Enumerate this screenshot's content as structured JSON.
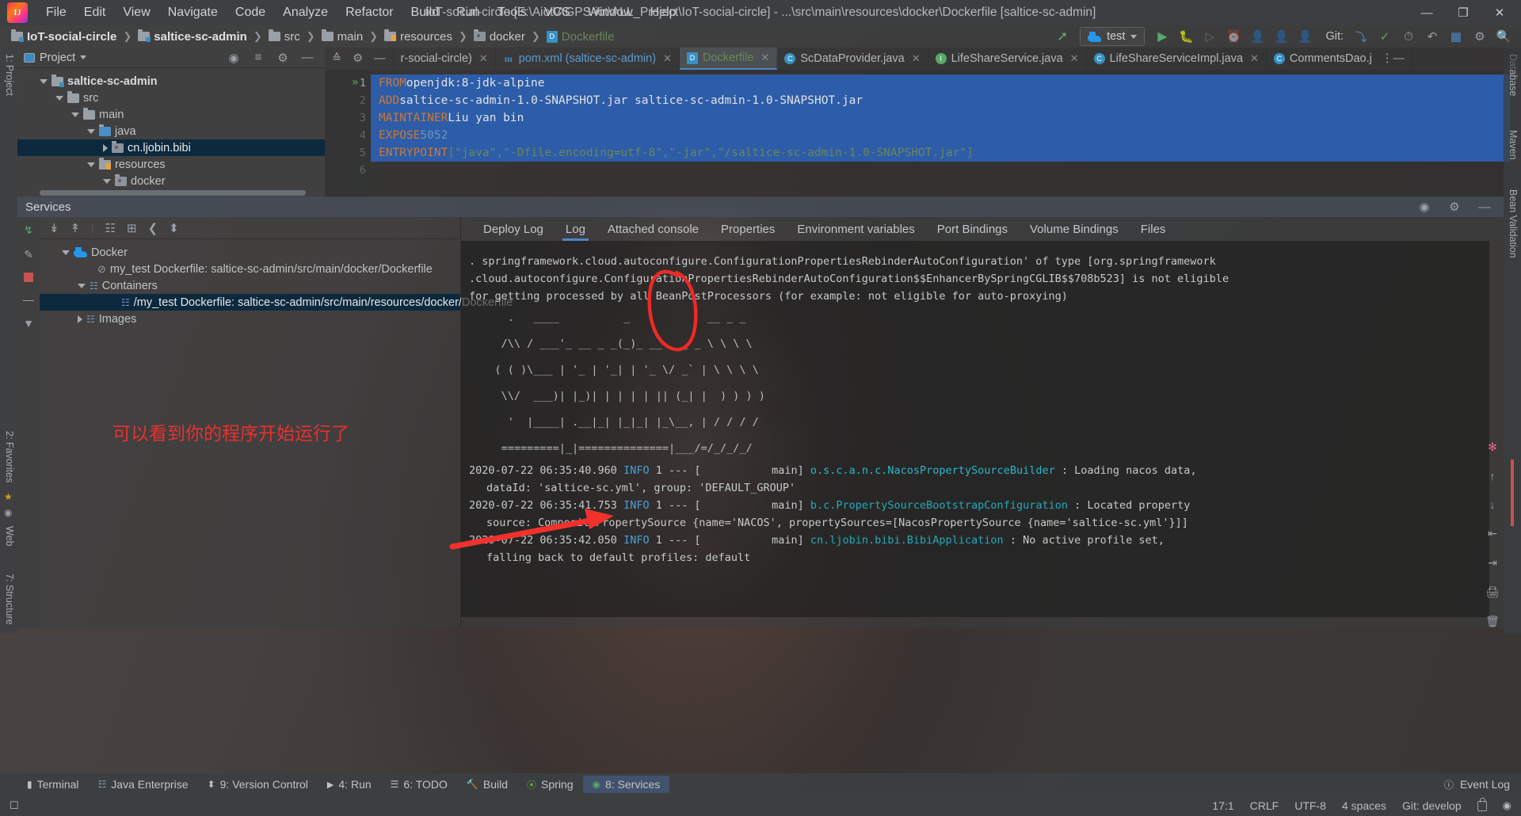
{
  "window": {
    "title": "IoT-social-circle [E:\\Aiot\\AGPS-iot\\ALL_Project\\IoT-social-circle] - ...\\src\\main\\resources\\docker\\Dockerfile [saltice-sc-admin]",
    "minimize": "—",
    "maximize": "❐",
    "close": "✕"
  },
  "menu": {
    "items": [
      {
        "label": "File"
      },
      {
        "label": "Edit"
      },
      {
        "label": "View"
      },
      {
        "label": "Navigate"
      },
      {
        "label": "Code"
      },
      {
        "label": "Analyze"
      },
      {
        "label": "Refactor"
      },
      {
        "label": "Build"
      },
      {
        "label": "Run"
      },
      {
        "label": "Tools"
      },
      {
        "label": "VCS"
      },
      {
        "label": "Window"
      },
      {
        "label": "Help"
      }
    ]
  },
  "navbar": {
    "crumbs": [
      {
        "label": "IoT-social-circle",
        "icon": "module-folder-icon"
      },
      {
        "label": "saltice-sc-admin",
        "icon": "module-folder-icon"
      },
      {
        "label": "src",
        "icon": "folder-icon"
      },
      {
        "label": "main",
        "icon": "folder-icon"
      },
      {
        "label": "resources",
        "icon": "resources-folder-icon"
      },
      {
        "label": "docker",
        "icon": "folder-icon"
      },
      {
        "label": "Dockerfile",
        "icon": "dockerfile-icon"
      }
    ],
    "separator": "❯",
    "run_config": "test",
    "git_label": "Git:",
    "icons": {
      "build": "build-hammer-icon",
      "run": "▶",
      "debug": "debug-bug-icon",
      "run_with_coverage": "coverage-icon",
      "profiler": "profiler-icon",
      "attach": "attach-icon",
      "stop": "stop-icon",
      "update_project": "update-project-icon",
      "commit": "commit-check-icon",
      "history": "history-icon",
      "rollback": "rollback-icon",
      "settings": "settings-gear-icon",
      "search": "search-icon",
      "layout": "layout-icon"
    }
  },
  "editor_tabs": [
    {
      "label": "r-social-circle)",
      "icon": "module-icon",
      "selected": false,
      "close": "✕"
    },
    {
      "label": "pom.xml (saltice-sc-admin)",
      "icon": "maven-icon",
      "selected": false,
      "close": "✕"
    },
    {
      "label": "Dockerfile",
      "icon": "dockerfile-icon",
      "selected": true,
      "close": "✕"
    },
    {
      "label": "ScDataProvider.java",
      "icon": "java-class-icon",
      "selected": false,
      "close": "✕"
    },
    {
      "label": "LifeShareService.java",
      "icon": "java-interface-icon",
      "selected": false,
      "close": "✕"
    },
    {
      "label": "LifeShareServiceImpl.java",
      "icon": "java-class-icon",
      "selected": false,
      "close": "✕"
    },
    {
      "label": "CommentsDao.j",
      "icon": "java-class-icon",
      "selected": false,
      "close": ""
    }
  ],
  "project_tool": {
    "title": "Project",
    "nodes": [
      {
        "label": "saltice-sc-admin",
        "depth": 1,
        "twisty": "down",
        "icon": "module-folder-icon",
        "bold": true,
        "selected": false
      },
      {
        "label": "src",
        "depth": 2,
        "twisty": "down",
        "icon": "folder-icon",
        "bold": false,
        "selected": false
      },
      {
        "label": "main",
        "depth": 3,
        "twisty": "down",
        "icon": "folder-icon",
        "bold": false,
        "selected": false
      },
      {
        "label": "java",
        "depth": 4,
        "twisty": "down",
        "icon": "source-folder-icon",
        "bold": false,
        "selected": false
      },
      {
        "label": "cn.ljobin.bibi",
        "depth": 5,
        "twisty": "right",
        "icon": "package-icon",
        "bold": false,
        "selected": true
      },
      {
        "label": "resources",
        "depth": 4,
        "twisty": "down",
        "icon": "resources-folder-icon",
        "bold": false,
        "selected": false
      },
      {
        "label": "docker",
        "depth": 5,
        "twisty": "down",
        "icon": "folder-icon",
        "bold": false,
        "selected": false
      }
    ]
  },
  "code": {
    "lines": [
      {
        "no": "1",
        "kw": "FROM",
        "rest": " openjdk:8-jdk-alpine",
        "selected": true,
        "runmark": true
      },
      {
        "no": "2",
        "kw": "ADD",
        "rest": " saltice-sc-admin-1.0-SNAPSHOT.jar saltice-sc-admin-1.0-SNAPSHOT.jar",
        "selected": true,
        "runmark": false
      },
      {
        "no": "3",
        "kw": "MAINTAINER",
        "rest": " Liu yan bin",
        "selected": true,
        "runmark": false
      },
      {
        "no": "4",
        "kw": "EXPOSE",
        "rest": " 5052",
        "selected": true,
        "runmark": false
      },
      {
        "no": "5",
        "kw": "ENTRYPOINT",
        "rest": " [\"java\",\"-Dfile.encoding=utf-8\",\"-jar\",\"/saltice-sc-admin-1.0-SNAPSHOT.jar\"]",
        "selected": true,
        "runmark": false
      },
      {
        "no": "6",
        "kw": "",
        "rest": "",
        "selected": false,
        "runmark": false
      }
    ]
  },
  "left_strip": [
    {
      "label": "1: Project"
    },
    {
      "label": "2: Favorites"
    },
    {
      "label": "Web"
    },
    {
      "label": "7: Structure"
    }
  ],
  "right_strip": [
    {
      "label": "Database"
    },
    {
      "label": "Maven"
    },
    {
      "label": "Bean Validation"
    }
  ],
  "services": {
    "title": "Services",
    "toolbar_icons": [
      "rerun-icon",
      "expand-all-icon",
      "collapse-all-icon",
      "group-icon",
      "add-icon",
      "share-icon",
      "branch-icon"
    ],
    "gutter_icons": [
      "rerun-icon",
      "edit-icon",
      "stop-icon",
      "minus-icon",
      "filter-icon"
    ],
    "settings_icon": "settings-gear-icon",
    "hide_icon": "—",
    "locate_icon": "locate-icon",
    "tree": [
      {
        "label": "Docker",
        "depth": 1,
        "twisty": "down",
        "icon": "docker-whale-icon",
        "selected": false
      },
      {
        "label": "my_test Dockerfile: saltice-sc-admin/src/main/docker/Dockerfile",
        "depth": 2,
        "twisty": "none",
        "icon": "disabled-icon",
        "selected": false
      },
      {
        "label": "Containers",
        "depth": 2,
        "twisty": "down",
        "icon": "containers-icon",
        "selected": false
      },
      {
        "label": "/my_test Dockerfile: saltice-sc-admin/src/main/resources/docker/Dockerfile",
        "depth": 3,
        "twisty": "none",
        "icon": "container-icon",
        "selected": true
      },
      {
        "label": "Images",
        "depth": 2,
        "twisty": "right",
        "icon": "images-icon",
        "selected": false
      }
    ],
    "tabs": [
      {
        "label": "Deploy Log",
        "selected": false
      },
      {
        "label": "Log",
        "selected": true
      },
      {
        "label": "Attached console",
        "selected": false
      },
      {
        "label": "Properties",
        "selected": false
      },
      {
        "label": "Environment variables",
        "selected": false
      },
      {
        "label": "Port Bindings",
        "selected": false
      },
      {
        "label": "Volume Bindings",
        "selected": false
      },
      {
        "label": "Files",
        "selected": false
      }
    ],
    "rail_icons": [
      "bug-icon",
      "scroll-up-icon",
      "scroll-down-icon",
      "soft-wrap-icon",
      "scroll-end-icon",
      "print-icon",
      "trash-icon"
    ],
    "log": {
      "top_partial_1": ". springframework.cloud.autoconfigure.ConfigurationPropertiesRebinderAutoConfiguration' of type [org.springframework",
      "top_partial_2": ".cloud.autoconfigure.ConfigurationPropertiesRebinderAutoConfiguration$$EnhancerBySpringCGLIB$$708b523] is not eligible",
      "top_partial_3": "for getting processed by all BeanPostProcessors (for example: not eligible for auto-proxying)",
      "banner": [
        "      .   ____          _            __ _ _",
        "     /\\\\ / ___'_ __ _ _(_)_ __  __ _ \\ \\ \\ \\",
        "    ( ( )\\___ | '_ | '_| | '_ \\/ _` | \\ \\ \\ \\",
        "     \\\\/  ___)| |_)| | | | | || (_| |  ) ) ) )",
        "      '  |____| .__|_| |_|_| |_\\__, | / / / /",
        "     =========|_|==============|___/=/_/_/_/"
      ],
      "entries": [
        {
          "time": "2020-07-22 06:35:40.960",
          "level": "INFO",
          "pid": "1",
          "sep": "---",
          "thread": "[           main]",
          "logger": "o.s.c.a.n.c.NacosPropertySourceBuilder",
          "colon": ":",
          "message": "Loading nacos data,",
          "cont": "dataId: 'saltice-sc.yml', group: 'DEFAULT_GROUP'"
        },
        {
          "time": "2020-07-22 06:35:41.753",
          "level": "INFO",
          "pid": "1",
          "sep": "---",
          "thread": "[           main]",
          "logger": "b.c.PropertySourceBootstrapConfiguration",
          "colon": ":",
          "message": "Located property",
          "cont": "source: CompositePropertySource {name='NACOS', propertySources=[NacosPropertySource {name='saltice-sc.yml'}]]"
        },
        {
          "time": "2020-07-22 06:35:42.050",
          "level": "INFO",
          "pid": "1",
          "sep": "---",
          "thread": "[           main]",
          "logger": "cn.ljobin.bibi.BibiApplication",
          "colon": ":",
          "message": "No active profile set,",
          "cont": "falling back to default profiles: default"
        }
      ]
    }
  },
  "annotation": {
    "text": "可以看到你的程序开始运行了",
    "color": "#e8312f"
  },
  "bottom_bar": {
    "items": [
      {
        "label": "Terminal",
        "icon": "terminal-icon",
        "selected": false
      },
      {
        "label": "Java Enterprise",
        "icon": "java-ee-icon",
        "selected": false
      },
      {
        "label": "9: Version Control",
        "icon": "vcs-icon",
        "selected": false
      },
      {
        "label": "4: Run",
        "icon": "run-icon",
        "selected": false
      },
      {
        "label": "6: TODO",
        "icon": "todo-icon",
        "selected": false
      },
      {
        "label": "Build",
        "icon": "build-icon",
        "selected": false
      },
      {
        "label": "Spring",
        "icon": "spring-icon",
        "selected": false
      },
      {
        "label": "8: Services",
        "icon": "services-icon",
        "selected": true
      }
    ],
    "event_log": "Event Log",
    "event_log_icon": "event-log-icon"
  },
  "status_bar": {
    "caret": "17:1",
    "line_sep": "CRLF",
    "encoding": "UTF-8",
    "indent": "4 spaces",
    "git_branch": "Git: develop",
    "lock_icon": "lock-icon",
    "inspection_icon": "inspection-icon"
  }
}
